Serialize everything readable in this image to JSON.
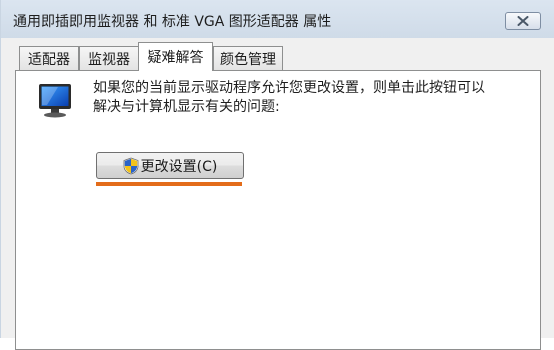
{
  "window": {
    "title": "通用即插即用监视器 和 标准 VGA 图形适配器 属性"
  },
  "tabs": [
    {
      "label": "适配器"
    },
    {
      "label": "监视器"
    },
    {
      "label": "疑难解答",
      "active": true
    },
    {
      "label": "颜色管理"
    }
  ],
  "troubleshoot": {
    "description_line1": "如果您的当前显示驱动程序允许您更改设置，则单击此按钮可以",
    "description_line2": "解决与计算机显示有关的问题:",
    "change_button_label": "更改设置(C)"
  },
  "colors": {
    "highlight": "#e36c1a"
  },
  "icons": {
    "monitor": "monitor-icon",
    "shield": "uac-shield-icon",
    "close": "close-icon"
  }
}
